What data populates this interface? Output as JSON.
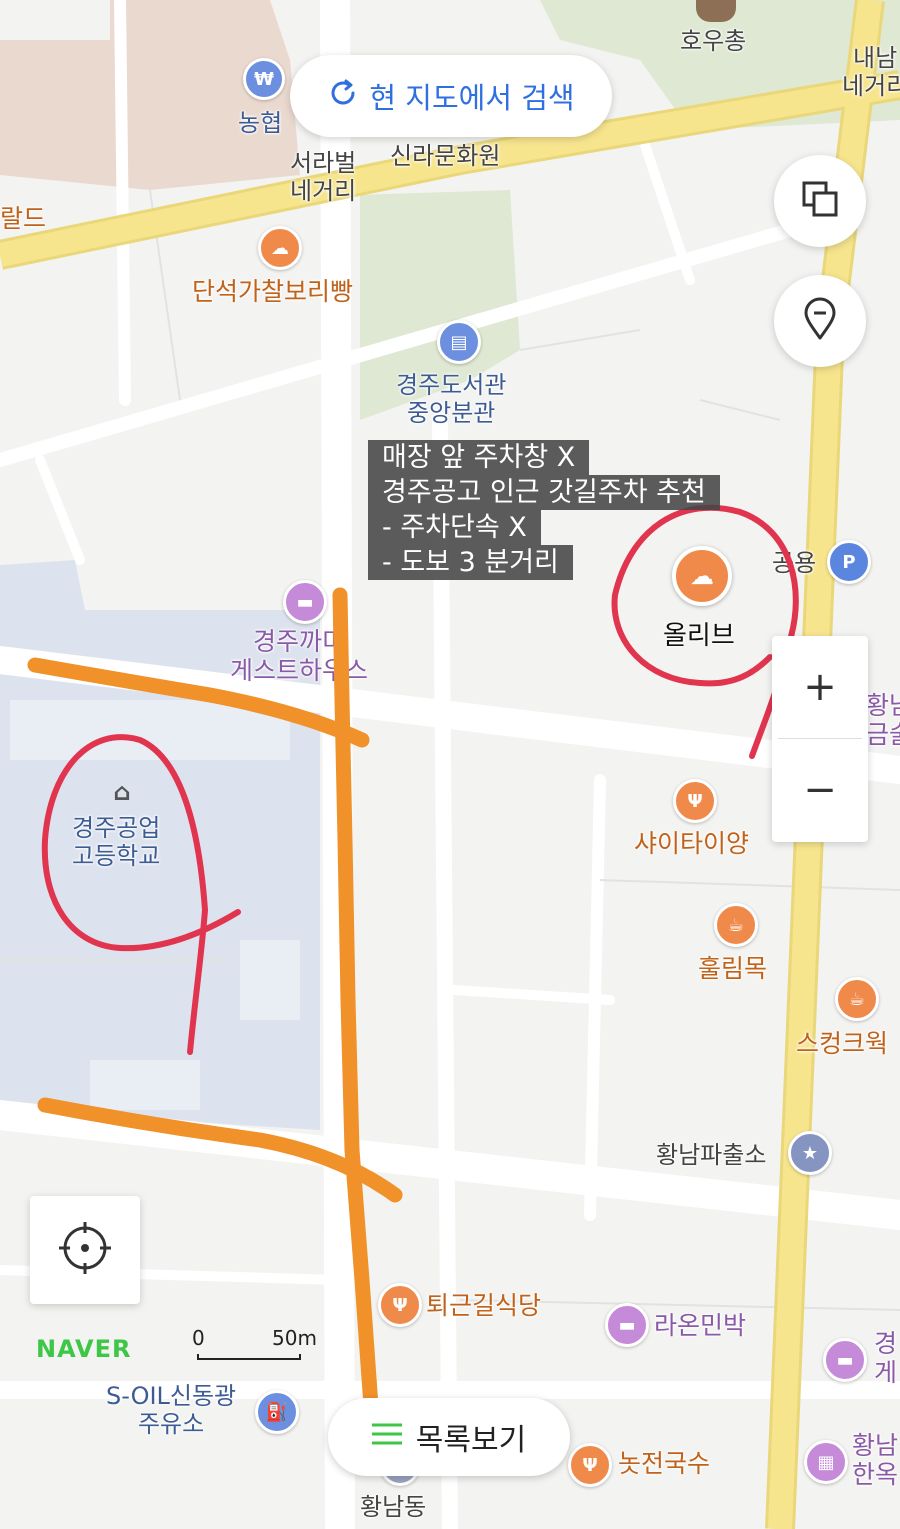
{
  "search_button": {
    "label": "현 지도에서 검색"
  },
  "list_button": {
    "label": "목록보기"
  },
  "brand": {
    "name": "NAVER"
  },
  "scale_bar": {
    "start": "0",
    "end": "50m"
  },
  "note_overlay": {
    "lines": [
      "매장 앞 주차창 X",
      "경주공고 인근 갓길주차 추천",
      "- 주차단속 X",
      "- 도보 3 분거리"
    ]
  },
  "destination": {
    "name": "올리브"
  },
  "places": {
    "hou_chong": "호우총",
    "naeam_intersection": "내남\n네거리",
    "nonghyup": "농협",
    "silla_culture": "신라문화원",
    "seorabeol_intersection": "서라벌\n네거리",
    "hwald": "랄드",
    "danseok_bakery": "단석가찰보리빵",
    "library": "경주도서관\n중앙분관",
    "parking": "공용",
    "guesthouse": "경주까미\n게스트하우스",
    "school": "경주공업\n고등학교",
    "shaitaiyang": "샤이타이양",
    "hwangnam_right1": "황남\n금술",
    "hullimmok": "훌림목",
    "skunk": "스컹크웍",
    "police": "황남파출소",
    "toegeun_restaurant": "퇴근길식당",
    "raon_minbak": "라온민박",
    "gyeong_right": "경\n게",
    "soil": "S-OIL신동광\n주유소",
    "nokjeon_noodle": "놋전국수",
    "hwangnam_hanok": "황남\n한옥",
    "hwangnam_dong": "황남동"
  },
  "colors": {
    "accent_blue": "#2f6fe0",
    "road_yellow": "#f7e58e",
    "green_area": "#dfe8d2",
    "school_area": "#dde3ee",
    "route_orange": "#f0912a",
    "annotation_red": "#e0344f",
    "naver_green": "#3ec646"
  },
  "icons": {
    "refresh": "refresh-icon",
    "layers": "layers-icon",
    "location_pin": "location-pin-icon",
    "zoom_in": "plus-icon",
    "zoom_out": "minus-icon",
    "crosshair": "crosshair-icon",
    "list": "list-icon"
  }
}
